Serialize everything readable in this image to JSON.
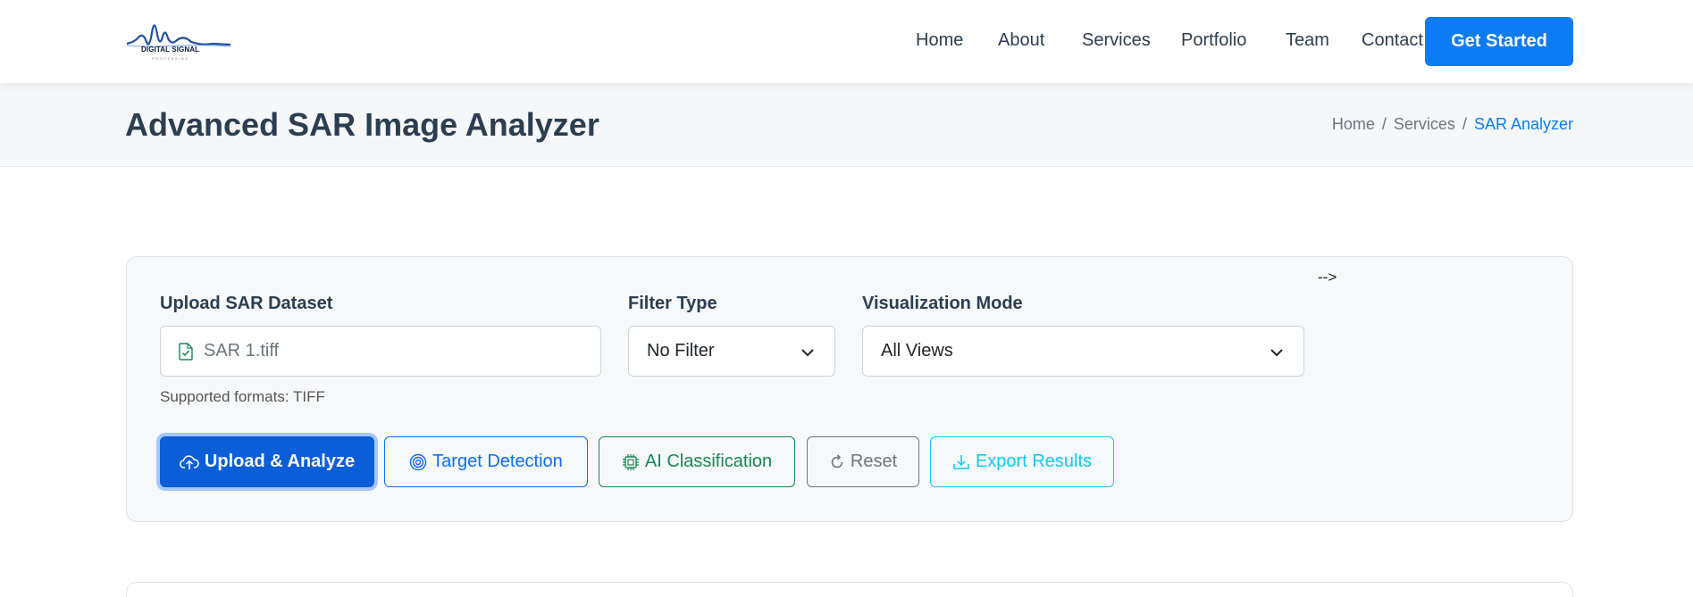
{
  "brand": {
    "logo_text": "DIGITAL SIGNAL",
    "logo_subtext": "PROCESSING"
  },
  "nav": {
    "items": [
      "Home",
      "About",
      "Services",
      "Portfolio",
      "Team",
      "Contact"
    ],
    "cta_label": "Get Started"
  },
  "page": {
    "title": "Advanced SAR Image Analyzer",
    "breadcrumb": [
      "Home",
      "Services",
      "SAR Analyzer"
    ]
  },
  "panel": {
    "stray_text": "-->",
    "upload": {
      "label": "Upload SAR Dataset",
      "value": "SAR 1.tiff",
      "hint": "Supported formats: TIFF"
    },
    "filter": {
      "label": "Filter Type",
      "selected": "No Filter"
    },
    "visualization": {
      "label": "Visualization Mode",
      "selected": "All Views"
    },
    "buttons": {
      "upload_analyze": "Upload & Analyze",
      "target_detection": "Target Detection",
      "ai_classification": "AI Classification",
      "reset": "Reset",
      "export": "Export Results"
    }
  },
  "colors": {
    "primary": "#0d7cf2",
    "primary_button": "#0b5ed7",
    "success": "#198754",
    "secondary": "#6c757d",
    "info": "#0dcaf0",
    "title_text": "#2c3e50"
  },
  "icons": {
    "file": "file-check-icon",
    "upload": "cloud-upload-icon",
    "target": "target-icon",
    "ai": "cpu-icon",
    "reset": "refresh-icon",
    "export": "download-icon",
    "chevron": "chevron-down-icon"
  }
}
